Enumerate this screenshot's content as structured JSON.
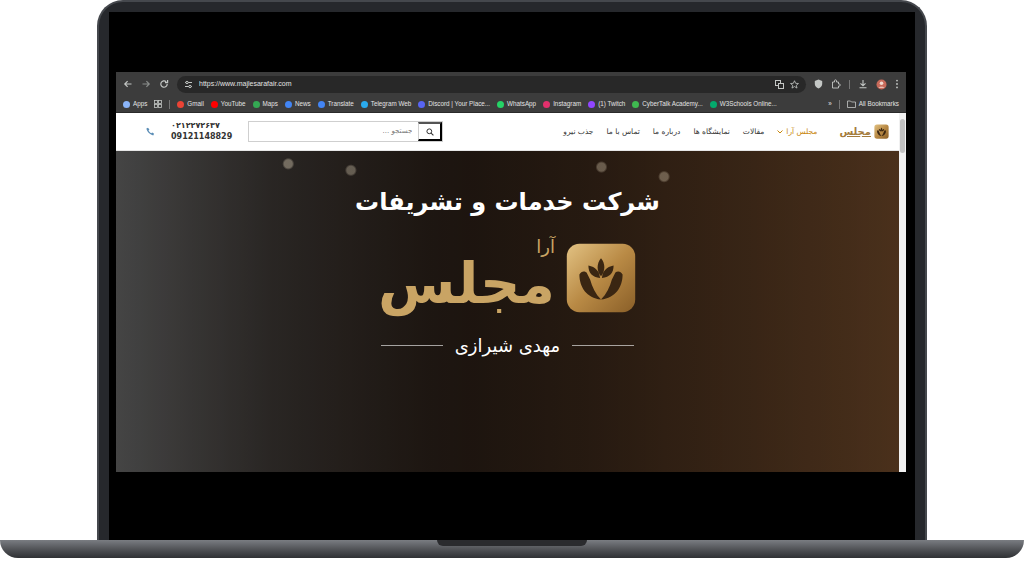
{
  "browser": {
    "url": "https://www.majlesarafair.com",
    "bookmarks": [
      {
        "label": "Apps",
        "color": "#8ab4f8"
      },
      {
        "label": "Gmail",
        "color": "#ea4335"
      },
      {
        "label": "YouTube",
        "color": "#ff0000"
      },
      {
        "label": "Maps",
        "color": "#34a853"
      },
      {
        "label": "News",
        "color": "#4285f4"
      },
      {
        "label": "Translate",
        "color": "#4285f4"
      },
      {
        "label": "Telegram Web",
        "color": "#2aabee"
      },
      {
        "label": "Discord | Your Place...",
        "color": "#5865f2"
      },
      {
        "label": "WhatsApp",
        "color": "#25d366"
      },
      {
        "label": "Instagram",
        "color": "#e1306c"
      },
      {
        "label": "(1) Twitch",
        "color": "#9146ff"
      },
      {
        "label": "CyberTalk Academy...",
        "color": "#3fb950"
      },
      {
        "label": "W3Schools Online...",
        "color": "#04aa6d"
      }
    ],
    "overflow": "»",
    "all_bookmarks": "All Bookmarks"
  },
  "site": {
    "logo_text": "مجلس",
    "menu": [
      {
        "label": "مجلس آرا",
        "selected": true,
        "has_submenu": true
      },
      {
        "label": "مقالات",
        "selected": false,
        "has_submenu": false
      },
      {
        "label": "نمایشگاه ها",
        "selected": false,
        "has_submenu": false
      },
      {
        "label": "درباره ما",
        "selected": false,
        "has_submenu": false
      },
      {
        "label": "تماس با ما",
        "selected": false,
        "has_submenu": false
      },
      {
        "label": "جذب نیرو",
        "selected": false,
        "has_submenu": false
      }
    ],
    "search": {
      "placeholder": "جستجو ..."
    },
    "phones": [
      "۰۲۱۲۲۷۲۶۳۷",
      "09121148829"
    ]
  },
  "hero": {
    "title": "شرکت خدمات و تشریفات",
    "brand_top": "آرا",
    "brand_main": "مجلس",
    "name": "مهدی شیرازی"
  }
}
